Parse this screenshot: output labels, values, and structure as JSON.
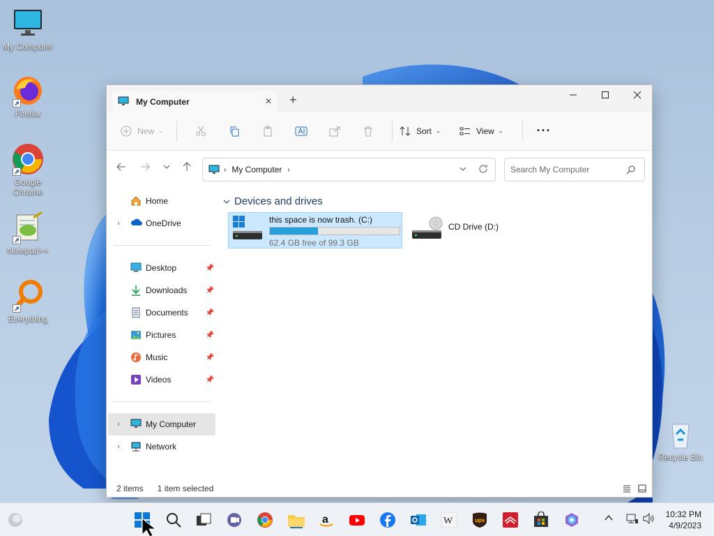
{
  "desktop": {
    "icons": [
      {
        "label": "My Computer"
      },
      {
        "label": "Firefox"
      },
      {
        "label": "Google Chrome"
      },
      {
        "label": "Notepad++"
      },
      {
        "label": "Everything"
      },
      {
        "label": "Recycle Bin"
      }
    ]
  },
  "window": {
    "tab_title": "My Computer",
    "toolbar": {
      "new_label": "New",
      "sort_label": "Sort",
      "view_label": "View"
    },
    "address": {
      "crumb": "My Computer"
    },
    "search": {
      "placeholder": "Search My Computer"
    },
    "sidebar": {
      "top": [
        {
          "label": "Home"
        },
        {
          "label": "OneDrive"
        }
      ],
      "quick": [
        {
          "label": "Desktop"
        },
        {
          "label": "Downloads"
        },
        {
          "label": "Documents"
        },
        {
          "label": "Pictures"
        },
        {
          "label": "Music"
        },
        {
          "label": "Videos"
        }
      ],
      "bottom": [
        {
          "label": "My Computer"
        },
        {
          "label": "Network"
        }
      ]
    },
    "content": {
      "section_title": "Devices and drives",
      "drives": [
        {
          "name": "this space is now trash. (C:)",
          "detail": "62.4 GB free of 99.3 GB",
          "used_fraction": 0.37
        },
        {
          "name": "CD Drive (D:)"
        }
      ]
    },
    "status": {
      "items": "2 items",
      "selected": "1 item selected"
    }
  },
  "taskbar": {
    "clock_time": "10:32 PM",
    "clock_date": "4/9/2023"
  },
  "colors": {
    "accent": "#0067c0",
    "selection_bg": "#cce8ff",
    "drive_fill": "#26a0da"
  }
}
